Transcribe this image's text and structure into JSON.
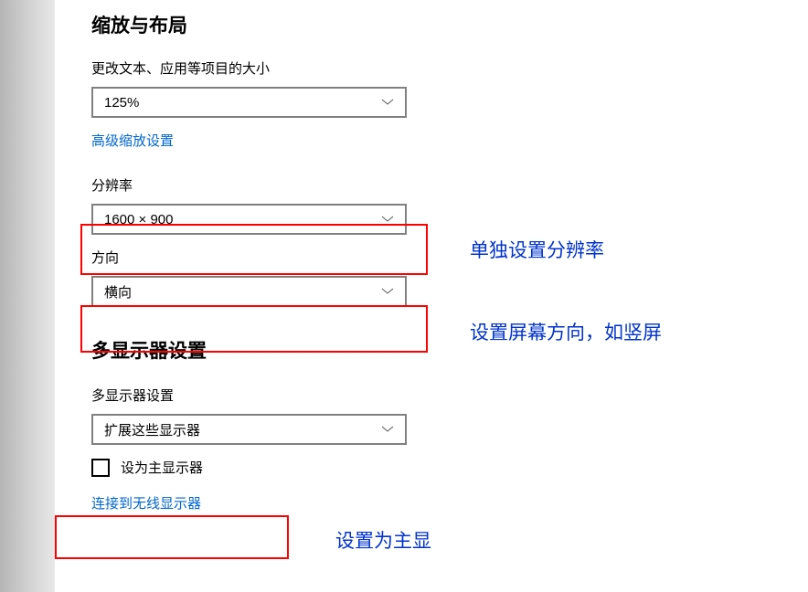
{
  "section1": {
    "title": "缩放与布局",
    "scale_label": "更改文本、应用等项目的大小",
    "scale_value": "125%",
    "advanced_link": "高级缩放设置",
    "resolution_label": "分辨率",
    "resolution_value": "1600 × 900",
    "orientation_label": "方向",
    "orientation_value": "横向"
  },
  "section2": {
    "title": "多显示器设置",
    "multi_label": "多显示器设置",
    "multi_value": "扩展这些显示器",
    "checkbox_label": "设为主显示器",
    "wireless_link": "连接到无线显示器"
  },
  "annotations": {
    "resolution_anno": "单独设置分辨率",
    "orientation_anno": "设置屏幕方向，如竖屏",
    "main_display_anno": "设置为主显"
  }
}
